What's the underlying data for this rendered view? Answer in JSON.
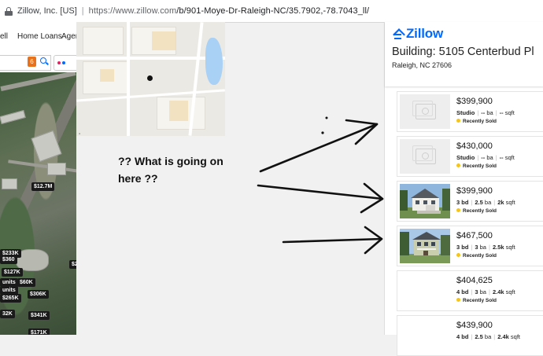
{
  "browser": {
    "site_name": "Zillow, Inc. [US]",
    "separator": "|",
    "url_main": "https://www.zillow.com",
    "url_path": "/b/901-Moye-Dr-Raleigh-NC/35.7902,-78.7043_ll/"
  },
  "nav": {
    "item_cut": "ell",
    "home_loans": "Home Loans",
    "agent_cut": "Agent"
  },
  "search": {
    "filter_count": "6"
  },
  "map_prices": [
    "$12.7M",
    "$233K",
    "$360",
    "$127K",
    "$2",
    "$60K",
    "units",
    "$306K",
    "$265K",
    "units",
    "$341K",
    "32K",
    "$171K"
  ],
  "annotation": {
    "line1": "?? What is going on",
    "line2": "here ??"
  },
  "panel": {
    "logo_text": "Zillow",
    "title": "Building: 5105 Centerbud Pl",
    "subtitle": "Raleigh, NC 27606"
  },
  "listings": [
    {
      "price": "$399,900",
      "beds": "Studio",
      "baths": "--",
      "baths_unit": "ba",
      "sqft": "--",
      "sqft_unit": "sqft",
      "status": "Recently Sold",
      "photo": false
    },
    {
      "price": "$430,000",
      "beds": "Studio",
      "baths": "--",
      "baths_unit": "ba",
      "sqft": "--",
      "sqft_unit": "sqft",
      "status": "Recently Sold",
      "photo": false
    },
    {
      "price": "$399,900",
      "beds": "3 bd",
      "baths": "2.5",
      "baths_unit": "ba",
      "sqft": "2k",
      "sqft_unit": "sqft",
      "status": "Recently Sold",
      "photo": true
    },
    {
      "price": "$467,500",
      "beds": "3 bd",
      "baths": "3",
      "baths_unit": "ba",
      "sqft": "2.5k",
      "sqft_unit": "sqft",
      "status": "Recently Sold",
      "photo": true
    },
    {
      "price": "$404,625",
      "beds": "4 bd",
      "baths": "3",
      "baths_unit": "ba",
      "sqft": "2.4k",
      "sqft_unit": "sqft",
      "status": "Recently Sold",
      "photo": false
    },
    {
      "price": "$439,900",
      "beds": "4 bd",
      "baths": "2.5",
      "baths_unit": "ba",
      "sqft": "2.4k",
      "sqft_unit": "sqft",
      "status": "",
      "photo": false
    }
  ],
  "colors": {
    "brand": "#006aff",
    "sold_dot": "#f5c518",
    "annotation_ink": "#111111"
  }
}
